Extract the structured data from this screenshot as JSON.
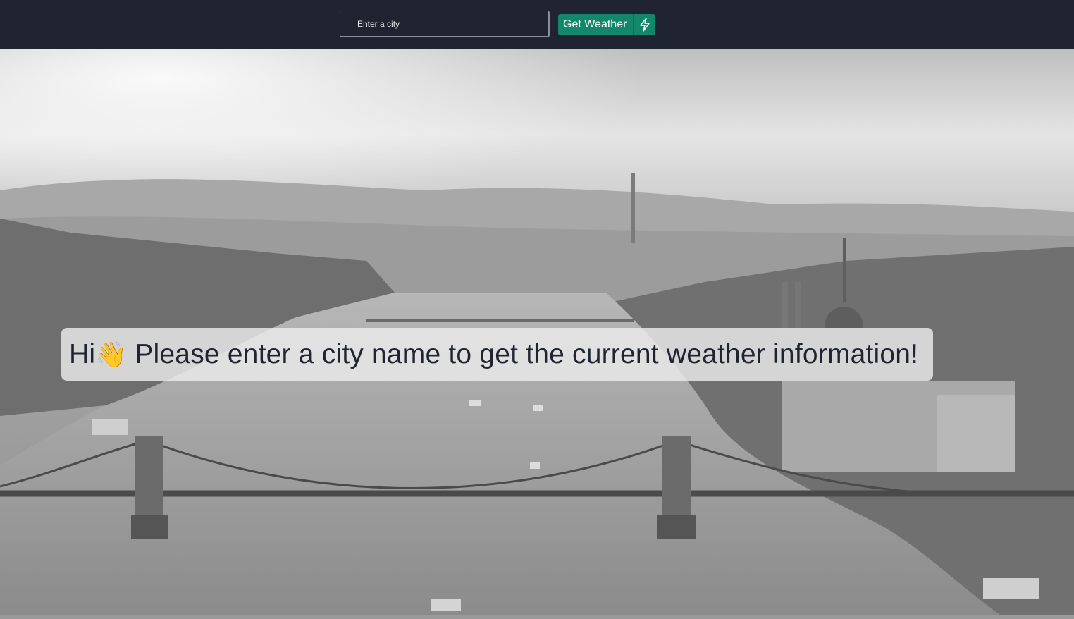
{
  "search": {
    "placeholder": "Enter a city",
    "value": ""
  },
  "button": {
    "label": "Get Weather",
    "icon": "lightning-bolt-icon"
  },
  "welcome": {
    "greeting": "Hi",
    "emoji": "👋",
    "message": " Please enter a city name to get the current weather information!"
  },
  "colors": {
    "topbar": "#1f2430",
    "button": "#12876a",
    "text_dark": "#1f2430"
  }
}
